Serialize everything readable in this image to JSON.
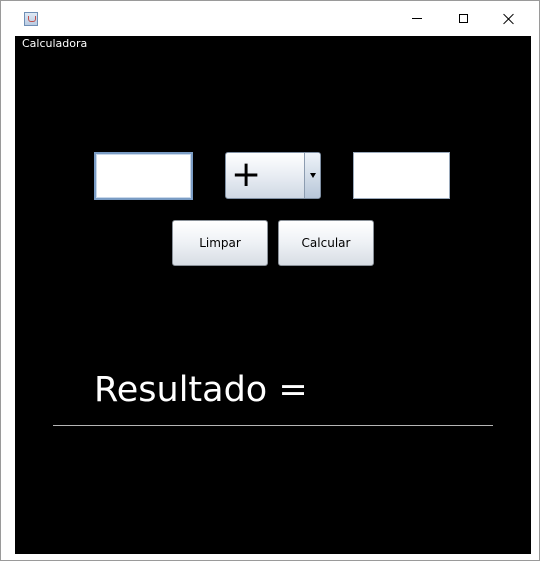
{
  "window": {
    "title": "",
    "frame_label": "Calculadora"
  },
  "calculator": {
    "first_number": "",
    "operator": "+",
    "second_number": "",
    "clear_label": "Limpar",
    "calculate_label": "Calcular",
    "result_label": "Resultado ="
  }
}
